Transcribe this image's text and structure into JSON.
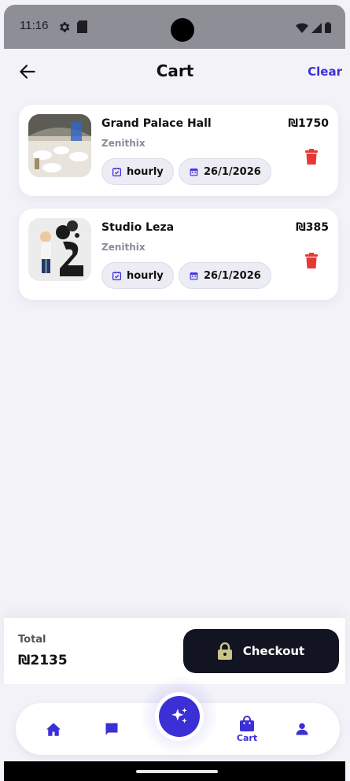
{
  "status_bar": {
    "time": "11:16"
  },
  "header": {
    "title": "Cart",
    "clear_label": "Clear"
  },
  "cart_items": [
    {
      "title": "Grand Palace Hall",
      "vendor": "Zenithix",
      "price": "₪1750",
      "rate": "hourly",
      "date": "26/1/2026"
    },
    {
      "title": "Studio Leza",
      "vendor": "Zenithix",
      "price": "₪385",
      "rate": "hourly",
      "date": "26/1/2026"
    }
  ],
  "summary": {
    "total_label": "Total",
    "total_value": "₪2135",
    "checkout_label": "Checkout"
  },
  "nav": {
    "cart_label": "Cart",
    "active": "cart"
  },
  "colors": {
    "accent": "#3b2fd6",
    "danger": "#e53935",
    "checkout_bg": "#121421"
  }
}
